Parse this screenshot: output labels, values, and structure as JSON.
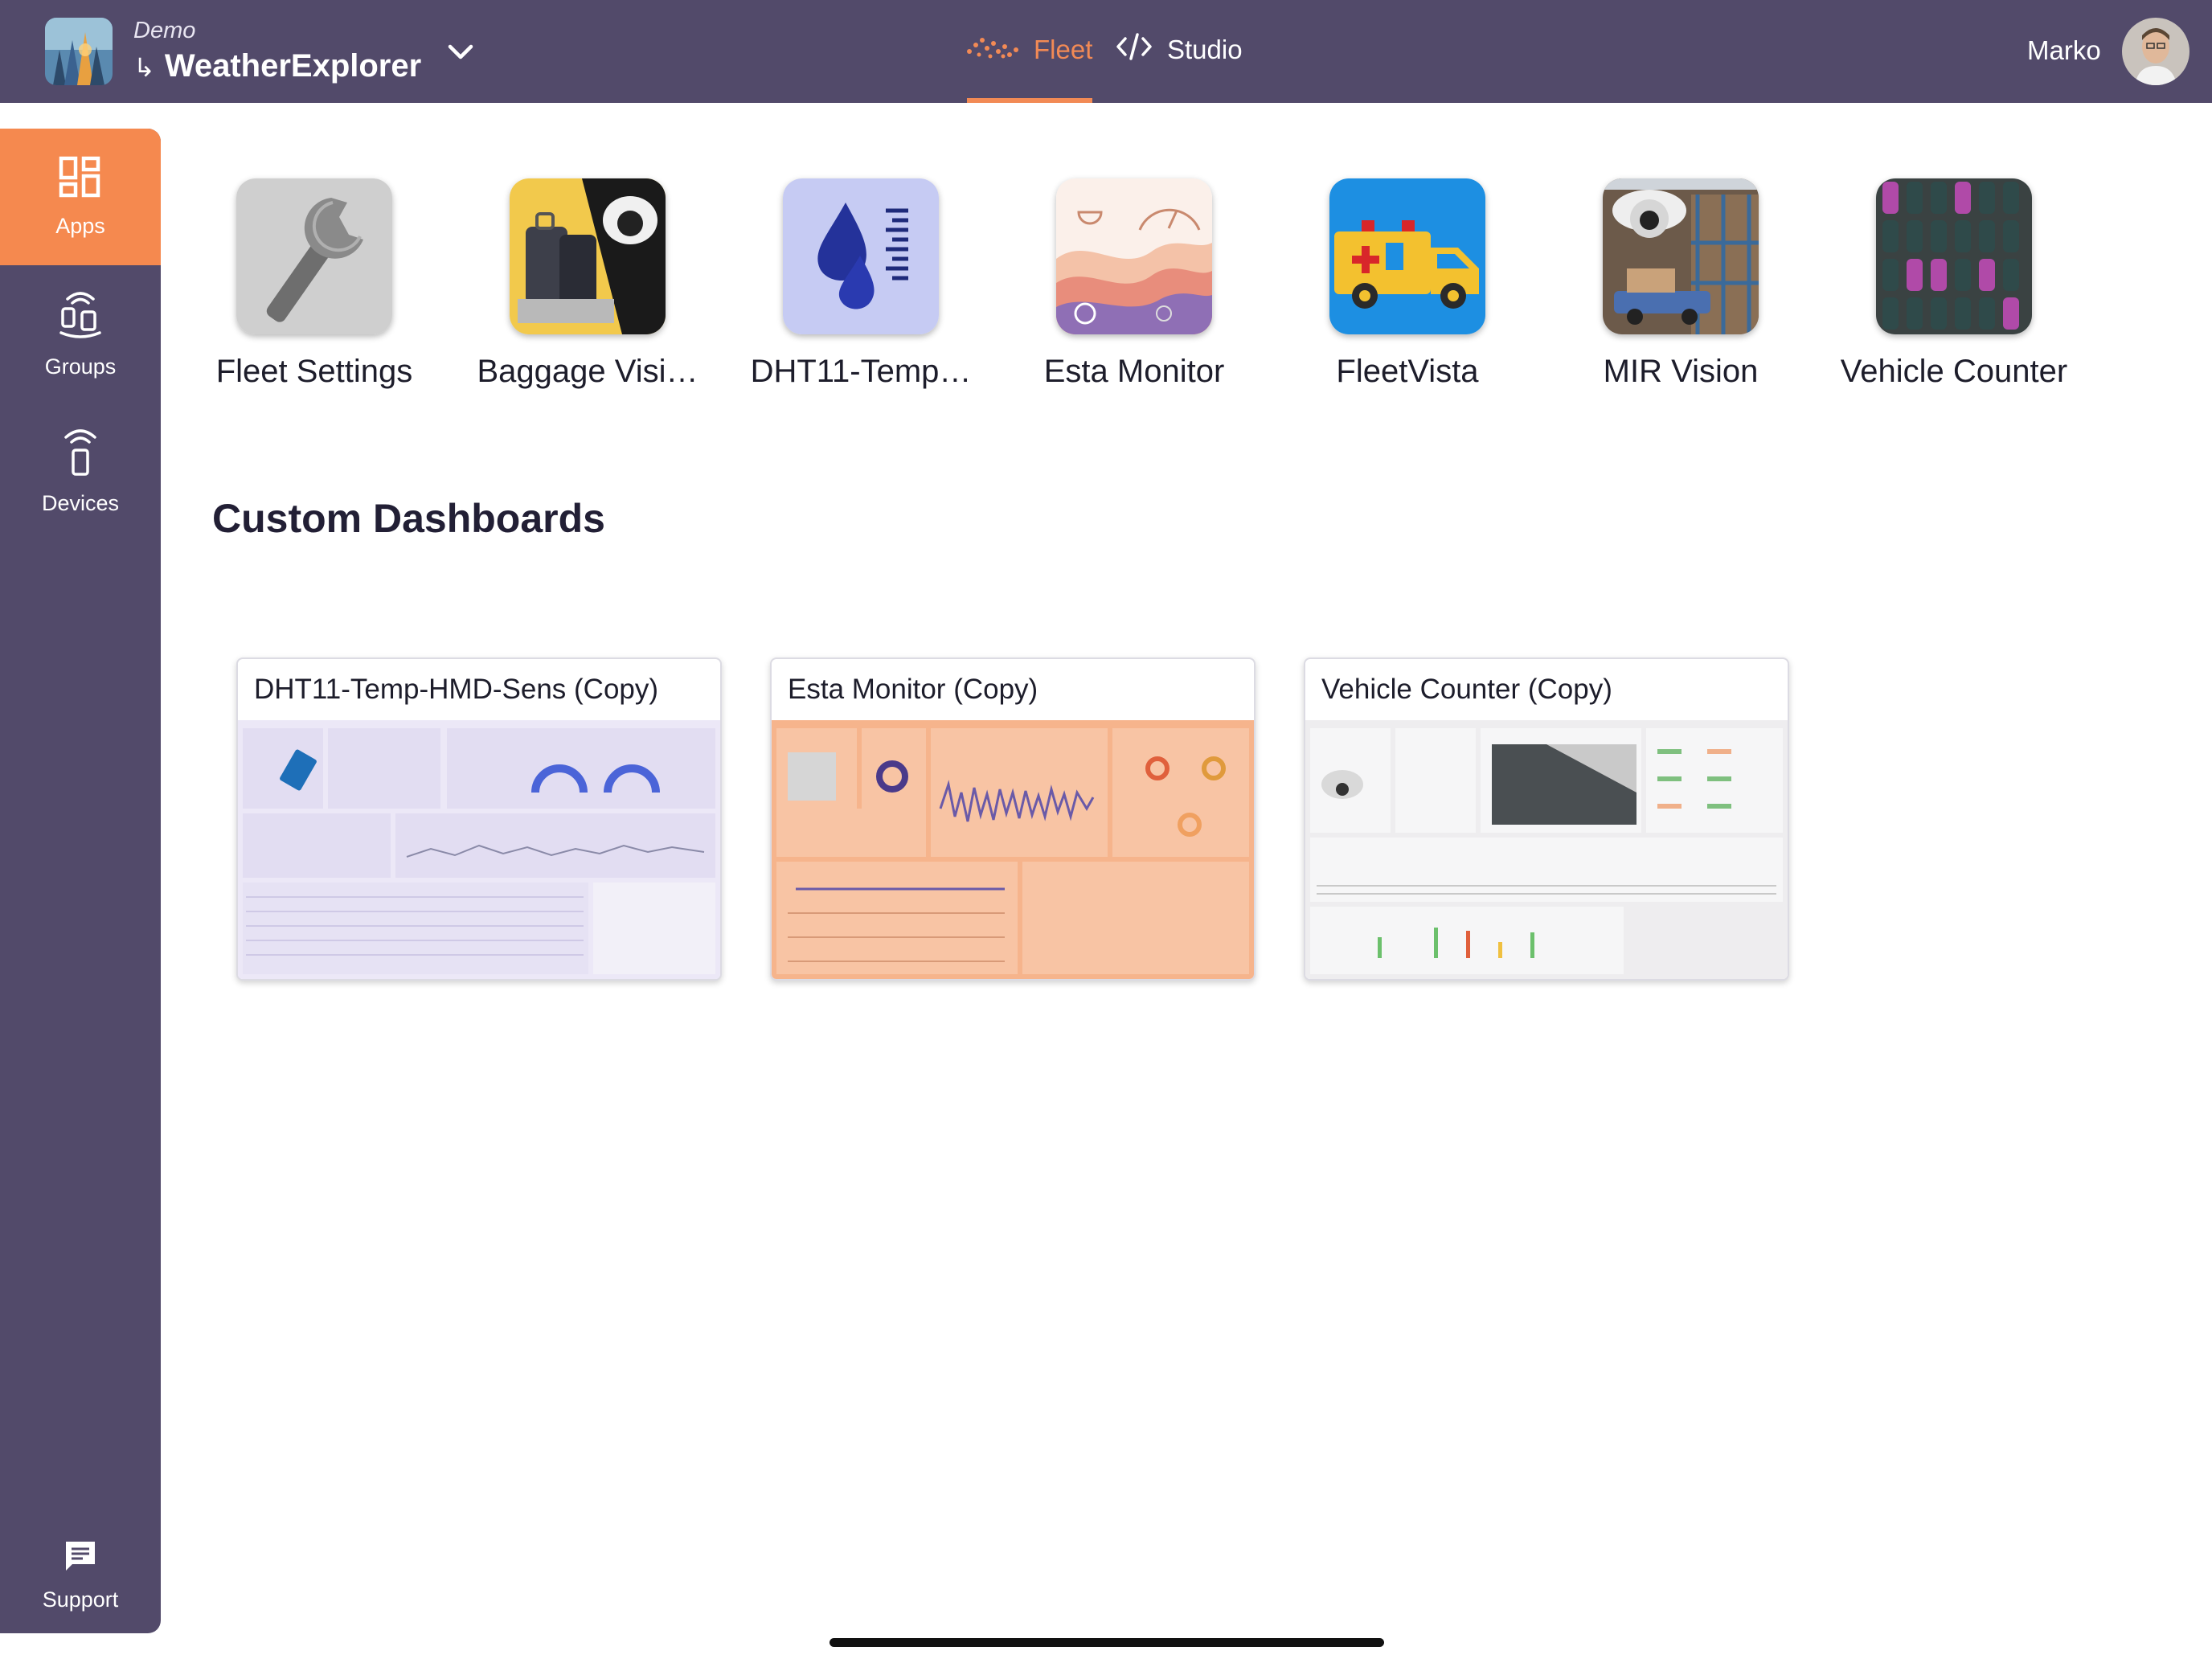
{
  "header": {
    "org_name": "Demo",
    "app_name": "WeatherExplorer",
    "tabs": [
      {
        "label": "Fleet",
        "active": true,
        "icon": "fleet-dots-icon"
      },
      {
        "label": "Studio",
        "active": false,
        "icon": "code-icon"
      }
    ],
    "user_name": "Marko"
  },
  "sidebar": {
    "items": [
      {
        "label": "Apps",
        "icon": "apps-grid-icon",
        "active": true
      },
      {
        "label": "Groups",
        "icon": "groups-icon",
        "active": false
      },
      {
        "label": "Devices",
        "icon": "device-icon",
        "active": false
      }
    ],
    "support_label": "Support"
  },
  "apps": [
    {
      "label": "Fleet Settings",
      "icon": "wrench-icon"
    },
    {
      "label": "Baggage Visi…",
      "icon": "baggage-camera-icon"
    },
    {
      "label": "DHT11-Temp…",
      "icon": "water-drops-icon"
    },
    {
      "label": "Esta Monitor",
      "icon": "waves-gauge-icon"
    },
    {
      "label": "FleetVista",
      "icon": "ambulance-icon"
    },
    {
      "label": "MIR Vision",
      "icon": "warehouse-camera-icon"
    },
    {
      "label": "Vehicle Counter",
      "icon": "parking-lot-icon"
    }
  ],
  "custom_dashboards": {
    "title": "Custom Dashboards",
    "items": [
      {
        "title": "DHT11-Temp-HMD-Sens (Copy)",
        "theme": "#e9e4f5"
      },
      {
        "title": "Esta Monitor (Copy)",
        "theme": "#f6b48c"
      },
      {
        "title": "Vehicle Counter (Copy)",
        "theme": "#eeedef"
      }
    ]
  },
  "colors": {
    "header_bg": "#524a6a",
    "accent": "#f28a55",
    "sidebar_bg": "#524a6a"
  }
}
